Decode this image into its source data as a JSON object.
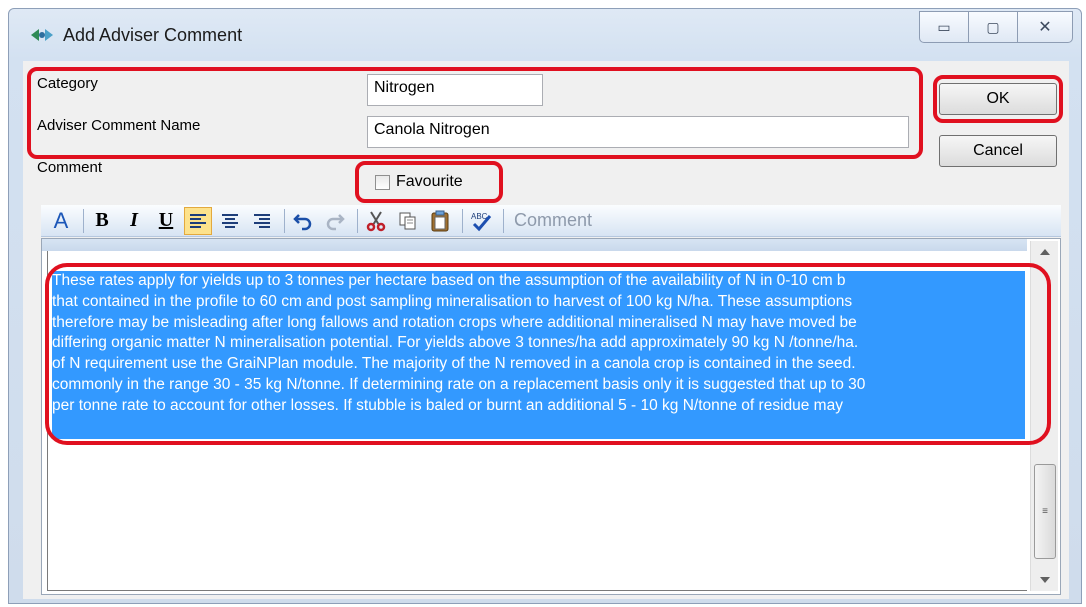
{
  "window": {
    "title": "Add Adviser Comment",
    "minimize_glyph": "▭",
    "maximize_glyph": "▢",
    "close_glyph": "✕"
  },
  "form": {
    "category_label": "Category",
    "category_value": "Nitrogen",
    "name_label": "Adviser Comment Name",
    "name_value": "Canola Nitrogen",
    "comment_label": "Comment",
    "favourite_label": "Favourite",
    "favourite_checked": false
  },
  "buttons": {
    "ok": "OK",
    "cancel": "Cancel"
  },
  "toolbar": {
    "font_color": "A",
    "bold": "B",
    "italic": "I",
    "underline": "U",
    "comment_label": "Comment",
    "icons": [
      "font-color-icon",
      "bold-icon",
      "italic-icon",
      "underline-icon",
      "align-left-icon",
      "align-center-icon",
      "align-right-icon",
      "undo-icon",
      "redo-icon",
      "cut-icon",
      "copy-icon",
      "paste-icon",
      "spellcheck-icon"
    ]
  },
  "editor": {
    "lines": [
      "These rates apply for yields up to 3 tonnes per hectare based on the assumption of the availability of N in 0-10 cm b",
      "that contained in the profile to 60 cm and post sampling mineralisation to harvest of 100 kg N/ha. These assumptions",
      "therefore may be misleading after long fallows and rotation crops where additional mineralised N may have moved be",
      "differing organic matter N mineralisation potential. For yields above 3 tonnes/ha add approximately 90 kg N /tonne/ha.",
      "of N requirement use the GraiNPlan module. The majority of the N removed in a canola crop is contained in the seed.",
      "commonly in the range 30 - 35 kg N/tonne. If determining rate on a replacement basis only it is suggested that up to 30",
      "per tonne rate to account for other losses. If stubble is baled or burnt an additional 5 - 10 kg N/tonne of residue may"
    ],
    "scroll_grip": "≡"
  },
  "colors": {
    "highlight": "#e0101f",
    "selection": "#3399ff",
    "active_tool": "#fde28c"
  }
}
